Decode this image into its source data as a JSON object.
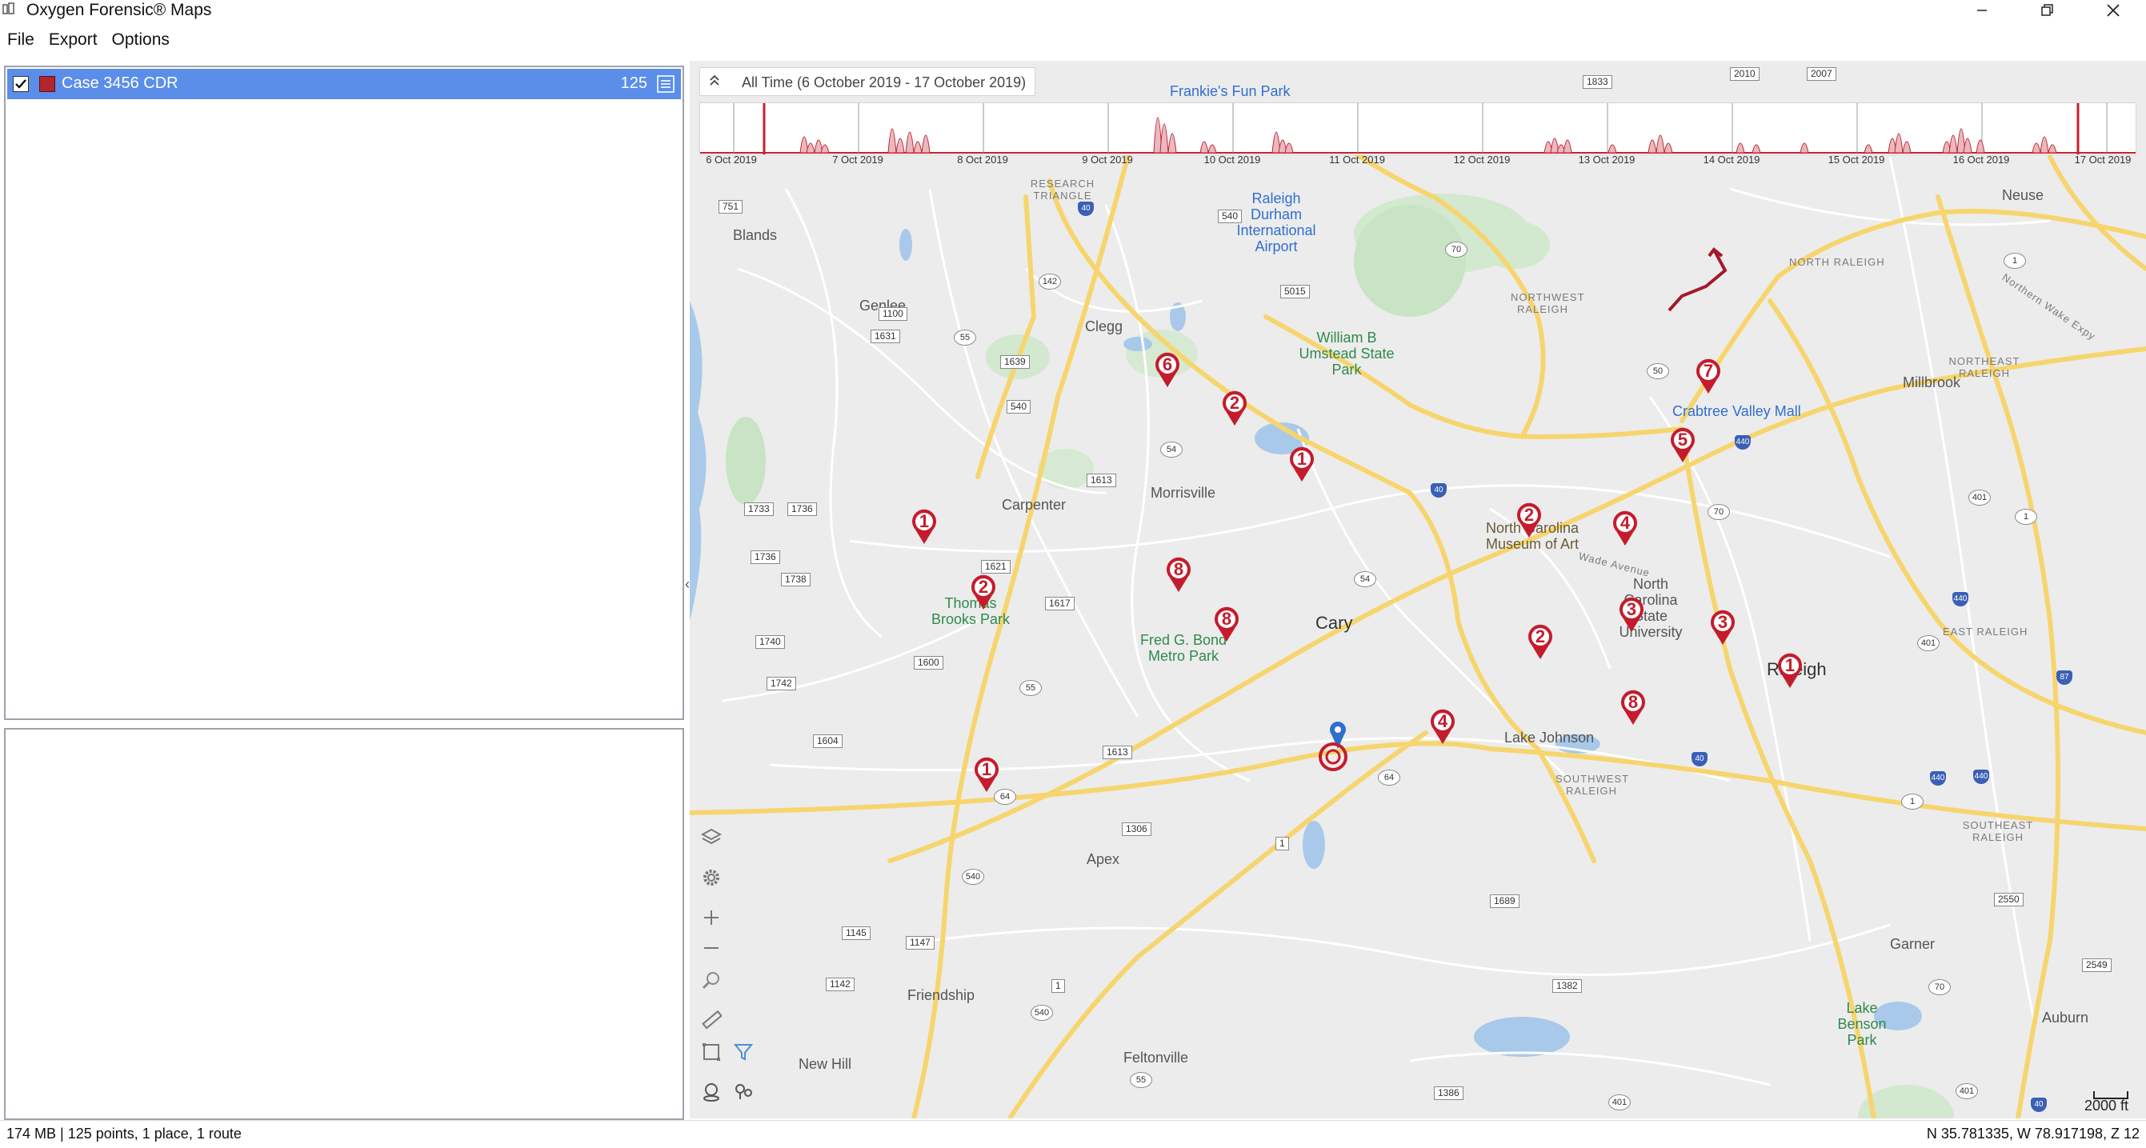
{
  "window": {
    "title": "Oxygen Forensic® Maps",
    "controls": [
      "minimize",
      "maximize",
      "close"
    ]
  },
  "menu": {
    "items": [
      "File",
      "Export",
      "Options"
    ]
  },
  "cases": {
    "items": [
      {
        "name": "Case 3456 CDR",
        "count": "125",
        "checked": true,
        "color": "#b3262e"
      }
    ]
  },
  "timeline": {
    "label": "All Time (6 October 2019 - 17 October 2019)",
    "ticks": [
      "6 Oct 2019",
      "7 Oct 2019",
      "8 Oct 2019",
      "9 Oct 2019",
      "10 Oct 2019",
      "11 Oct 2019",
      "12 Oct 2019",
      "13 Oct 2019",
      "14 Oct 2019",
      "15 Oct 2019",
      "16 Oct 2019",
      "17 Oct 2019"
    ],
    "activity_color": "#c8202c"
  },
  "map": {
    "places": {
      "blands": "Blands",
      "genlee": "Genlee",
      "clegg": "Clegg",
      "carpenter": "Carpenter",
      "morrisville": "Morrisville",
      "cary": "Cary",
      "apex": "Apex",
      "friendship": "Friendship",
      "new_hill": "New Hill",
      "feltonville": "Feltonville",
      "raleigh": "Raleigh",
      "neuse": "Neuse",
      "millbrook": "Millbrook",
      "garner": "Garner",
      "auburn": "Auburn",
      "lake_johnson": "Lake Johnson",
      "north_raleigh": "NORTH RALEIGH",
      "northwest_raleigh": "NORTHWEST RALEIGH",
      "northeast_raleigh": "NORTHEAST RALEIGH",
      "east_raleigh": "EAST RALEIGH",
      "southwest_raleigh": "SOUTHWEST RALEIGH",
      "southeast_raleigh": "SOUTHEAST RALEIGH",
      "research_triangle": "RESEARCH TRIANGLE",
      "wade_ave": "Wade Avenue",
      "northern_wake": "Northern Wake Expy"
    },
    "parks": {
      "umstead": "William B Umstead State Park",
      "thomas_brooks": "Thomas Brooks Park",
      "fred_bond": "Fred G. Bond Metro Park",
      "lake_benson": "Lake Benson Park"
    },
    "pois": {
      "frankies": "Frankie's Fun Park",
      "rdu_airport": "Raleigh Durham International Airport",
      "crabtree": "Crabtree Valley Mall",
      "museum": "North Carolina Museum of Art",
      "ncsu": "North Carolina State University"
    },
    "shields": [
      "751",
      "1100",
      "1631",
      "55",
      "1639",
      "142",
      "540",
      "540",
      "40",
      "5015",
      "70",
      "1833",
      "2010",
      "2007",
      "1733",
      "1736",
      "1736",
      "1738",
      "1740",
      "1742",
      "1604",
      "1621",
      "1617",
      "1600",
      "55",
      "1613",
      "1613",
      "64",
      "1306",
      "54",
      "54",
      "40",
      "540",
      "1145",
      "1147",
      "1142",
      "1",
      "540",
      "55",
      "1",
      "64",
      "1689",
      "1382",
      "1386",
      "401",
      "401",
      "440",
      "440",
      "440",
      "70",
      "2550",
      "2549",
      "40",
      "50",
      "1",
      "401",
      "1",
      "440",
      "401",
      "70",
      "87",
      "1",
      "40"
    ],
    "markers": [
      "6",
      "2",
      "1",
      "7",
      "5",
      "1",
      "2",
      "4",
      "8",
      "2",
      "8",
      "3",
      "3",
      "1",
      "2",
      "8",
      "4",
      "1"
    ],
    "route_color": "#a3192b",
    "scale": "2000 ft"
  },
  "tools": [
    "layers-icon",
    "settings-icon",
    "zoom-in-icon",
    "zoom-out-icon",
    "zoom-search-icon",
    "ruler-icon",
    "select-area-icon",
    "filter-icon",
    "pin-icon",
    "pins-icon"
  ],
  "status": {
    "left": "174 MB | 125 points, 1 place, 1 route",
    "right": "N 35.781335, W 78.917198, Z 12"
  }
}
